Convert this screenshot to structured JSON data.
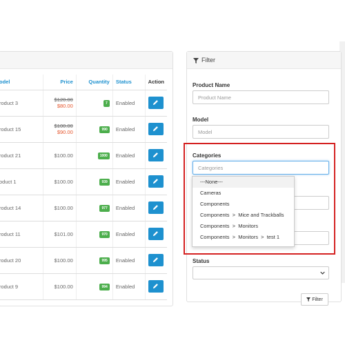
{
  "table": {
    "headers": {
      "model": "odel",
      "price": "Price",
      "quantity": "Quantity",
      "status": "Status",
      "action": "Action"
    },
    "rows": [
      {
        "model": "roduct 3",
        "price_old": "$120.00",
        "price_special": "$80.00",
        "quantity": "7",
        "status": "Enabled"
      },
      {
        "model": "roduct 15",
        "price_old": "$100.00",
        "price_special": "$90.00",
        "quantity": "990",
        "status": "Enabled"
      },
      {
        "model": "roduct 21",
        "price": "$100.00",
        "quantity": "1000",
        "status": "Enabled"
      },
      {
        "model": "oduct 1",
        "price": "$100.00",
        "quantity": "939",
        "status": "Enabled"
      },
      {
        "model": "roduct 14",
        "price": "$100.00",
        "quantity": "977",
        "status": "Enabled"
      },
      {
        "model": "roduct 11",
        "price": "$101.00",
        "quantity": "970",
        "status": "Enabled"
      },
      {
        "model": "roduct 20",
        "price": "$100.00",
        "quantity": "995",
        "status": "Enabled"
      },
      {
        "model": "roduct 9",
        "price": "$100.00",
        "quantity": "994",
        "status": "Enabled"
      }
    ]
  },
  "filter": {
    "title": "Filter",
    "product_name_label": "Product Name",
    "product_name_placeholder": "Product Name",
    "model_label": "Model",
    "model_placeholder": "Model",
    "categories_label": "Categories",
    "categories_placeholder": "Categories",
    "categories_options": [
      "---None---",
      "Cameras",
      "Components",
      "Components  >  Mice and Trackballs",
      "Components  >  Monitors",
      "Components  >  Monitors  >  test 1"
    ],
    "status_label": "Status",
    "filter_button": "Filter"
  },
  "colors": {
    "accent": "#1e91cf",
    "badge": "#4cae4c",
    "special_price": "#e5562d",
    "highlight": "#d42020"
  }
}
